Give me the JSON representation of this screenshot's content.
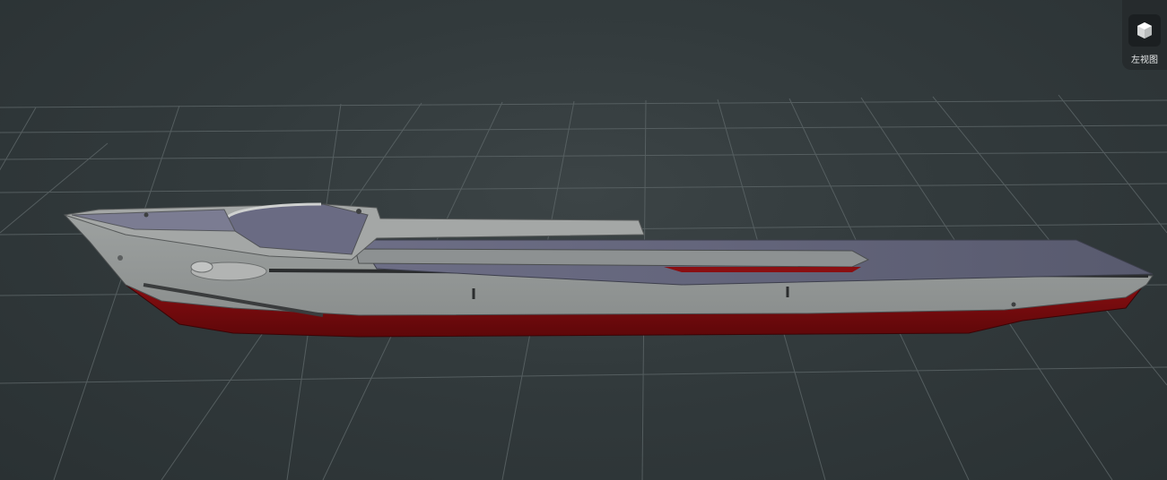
{
  "viewport": {
    "model": "ship-hull"
  },
  "view_control": {
    "icon": "cube-icon",
    "label": "左视图"
  }
}
